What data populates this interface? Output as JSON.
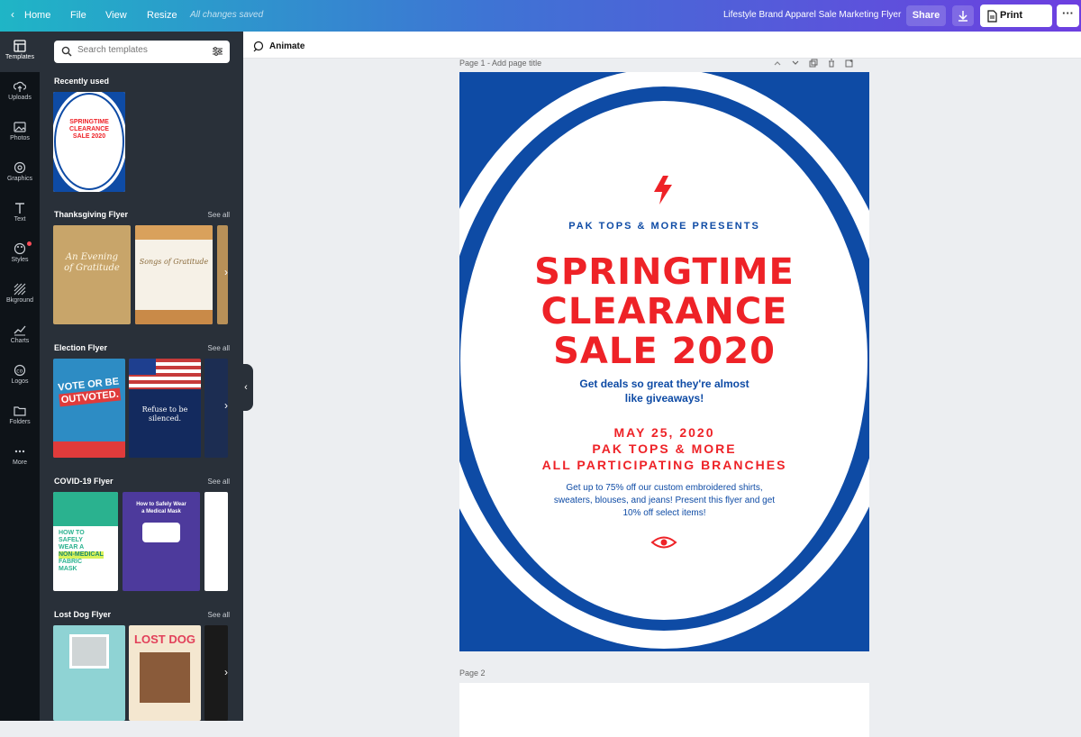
{
  "topbar": {
    "home": "Home",
    "file": "File",
    "view": "View",
    "resize": "Resize",
    "saved_status": "All changes saved",
    "doc_title": "Lifestyle Brand Apparel Sale Marketing Flyer",
    "share": "Share",
    "print": "Print Flyers"
  },
  "rail": [
    {
      "label": "Templates",
      "icon": "templates-icon"
    },
    {
      "label": "Uploads",
      "icon": "upload-cloud-icon"
    },
    {
      "label": "Photos",
      "icon": "photo-icon"
    },
    {
      "label": "Graphics",
      "icon": "shapes-icon"
    },
    {
      "label": "Text",
      "icon": "text-t-icon"
    },
    {
      "label": "Styles",
      "icon": "palette-icon"
    },
    {
      "label": "Bkground",
      "icon": "hatch-icon"
    },
    {
      "label": "Charts",
      "icon": "chart-line-icon"
    },
    {
      "label": "Logos",
      "icon": "logo-co-icon"
    },
    {
      "label": "Folders",
      "icon": "folder-icon"
    },
    {
      "label": "More",
      "icon": "more-dots-icon"
    }
  ],
  "panel": {
    "search_placeholder": "Search templates",
    "see_all": "See all",
    "sections": [
      {
        "title": "Recently used"
      },
      {
        "title": "Thanksgiving Flyer"
      },
      {
        "title": "Election Flyer"
      },
      {
        "title": "COVID-19 Flyer"
      },
      {
        "title": "Lost Dog Flyer"
      }
    ],
    "thumbs": {
      "recent": [
        "SPRINGTIME",
        "CLEARANCE",
        "SALE 2020"
      ],
      "thanks1": [
        "An Evening",
        "of Gratitude"
      ],
      "thanks2": "Songs of Gratitude",
      "elect1": [
        "VOTE OR BE",
        "OUTVOTED."
      ],
      "elect2": [
        "Refuse to be",
        "silenced."
      ],
      "covid1": [
        "HOW TO",
        "SAFELY",
        "WEAR A",
        "NON-MEDICAL",
        "FABRIC",
        "MASK"
      ],
      "covid2": [
        "How to Safely Wear",
        "a Medical Mask"
      ],
      "lostdog": "LOST DOG"
    }
  },
  "toolbar": {
    "animate": "Animate"
  },
  "canvas": {
    "page1_label": "Page 1 - Add page title",
    "page2_label": "Page 2"
  },
  "flyer": {
    "presenter": "PAK TOPS & MORE PRESENTS",
    "headline": [
      "SPRINGTIME",
      "CLEARANCE",
      "SALE 2020"
    ],
    "tagline": [
      "Get deals so great they're almost",
      "like giveaways!"
    ],
    "event": [
      "MAY 25, 2020",
      "PAK TOPS & MORE",
      "ALL PARTICIPATING BRANCHES"
    ],
    "body": [
      "Get up to 75% off our custom embroidered shirts,",
      "sweaters, blouses, and jeans! Present this flyer and get",
      "10% off select items!"
    ]
  },
  "colors": {
    "flyer_blue": "#0e4ba5",
    "flyer_red": "#ee2227",
    "panel_bg": "#293039",
    "rail_bg": "#0e1318"
  }
}
